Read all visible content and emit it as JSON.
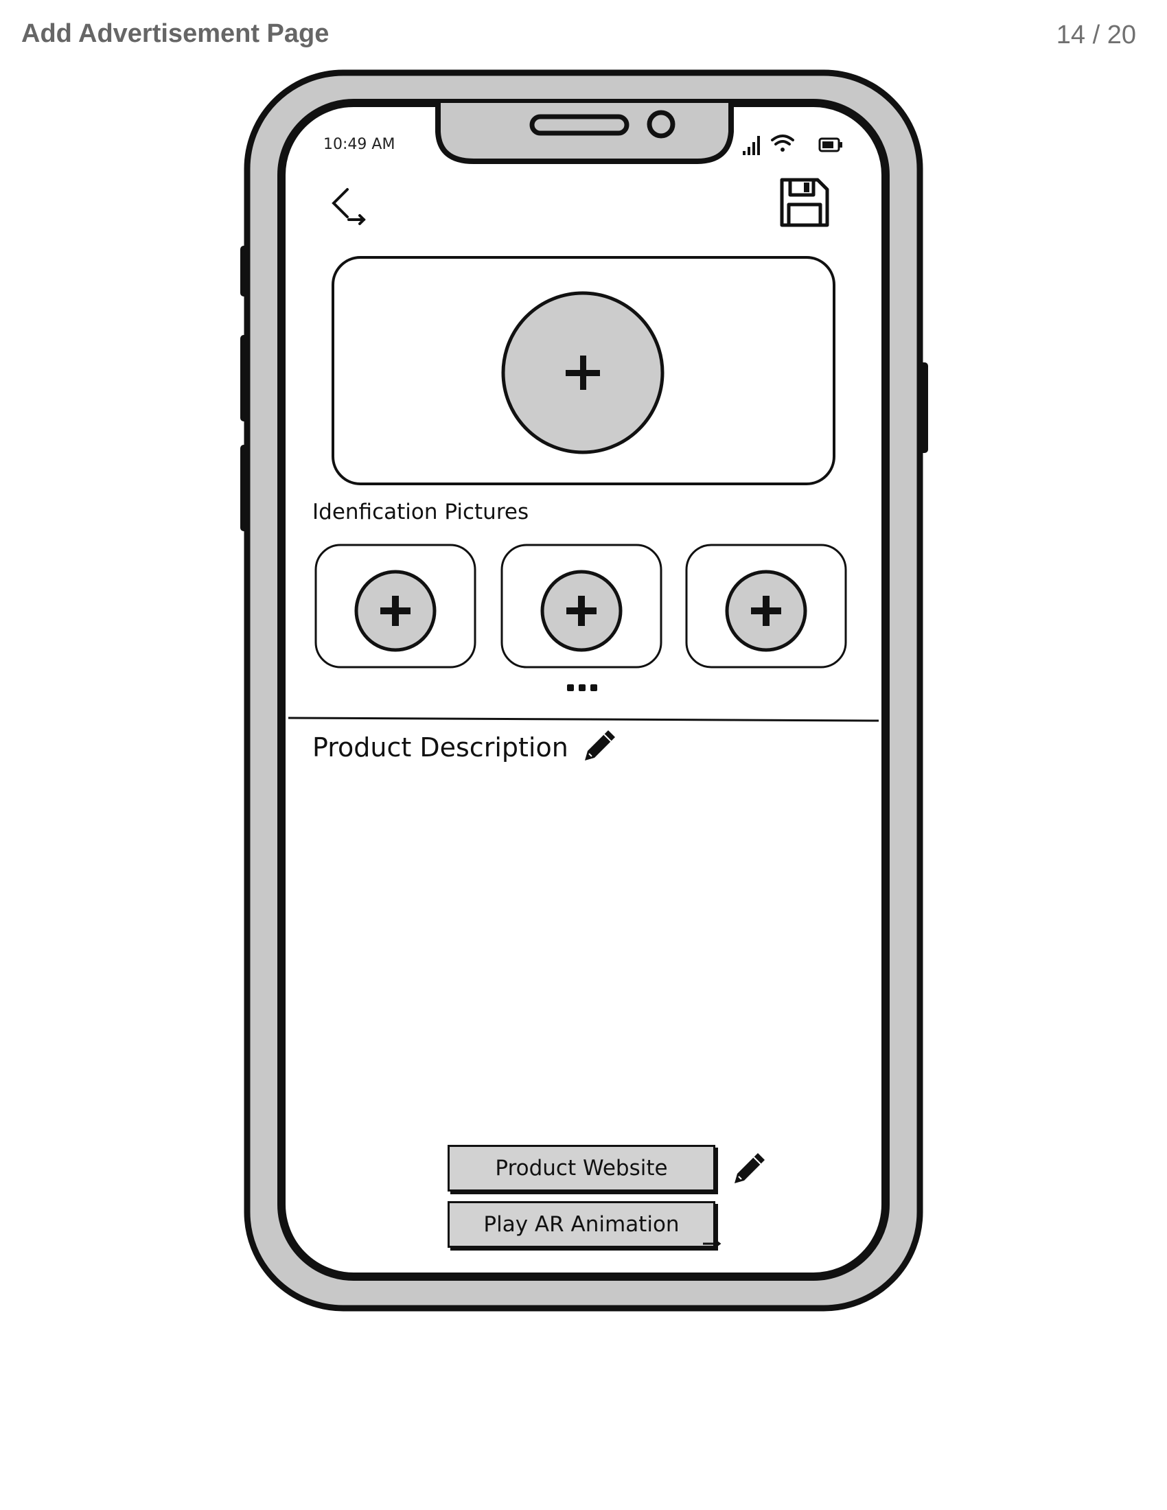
{
  "header": {
    "title": "Add Advertisement Page",
    "page_counter": "14 / 20"
  },
  "phone": {
    "status_bar": {
      "time": "10:49 AM",
      "icons": [
        "signal-icon",
        "wifi-icon",
        "battery-icon"
      ]
    },
    "toolbar": {
      "back_icon": "back-arrow-icon",
      "save_icon": "save-icon"
    },
    "main_picture": {
      "add_icon": "plus-icon"
    },
    "identification": {
      "label": "Idenfication Pictures",
      "slots": [
        {
          "icon": "plus-icon"
        },
        {
          "icon": "plus-icon"
        },
        {
          "icon": "plus-icon"
        }
      ],
      "more_icon": "ellipsis-icon"
    },
    "description": {
      "label": "Product Description",
      "edit_icon": "pencil-icon"
    },
    "buttons": {
      "website_label": "Product Website",
      "ar_label": "Play AR Animation",
      "website_edit_icon": "pencil-icon"
    }
  },
  "colors": {
    "phone_frame": "#c8c8c8",
    "outline": "#111111",
    "button_fill": "#d2d2d2",
    "header_text": "#666666"
  }
}
